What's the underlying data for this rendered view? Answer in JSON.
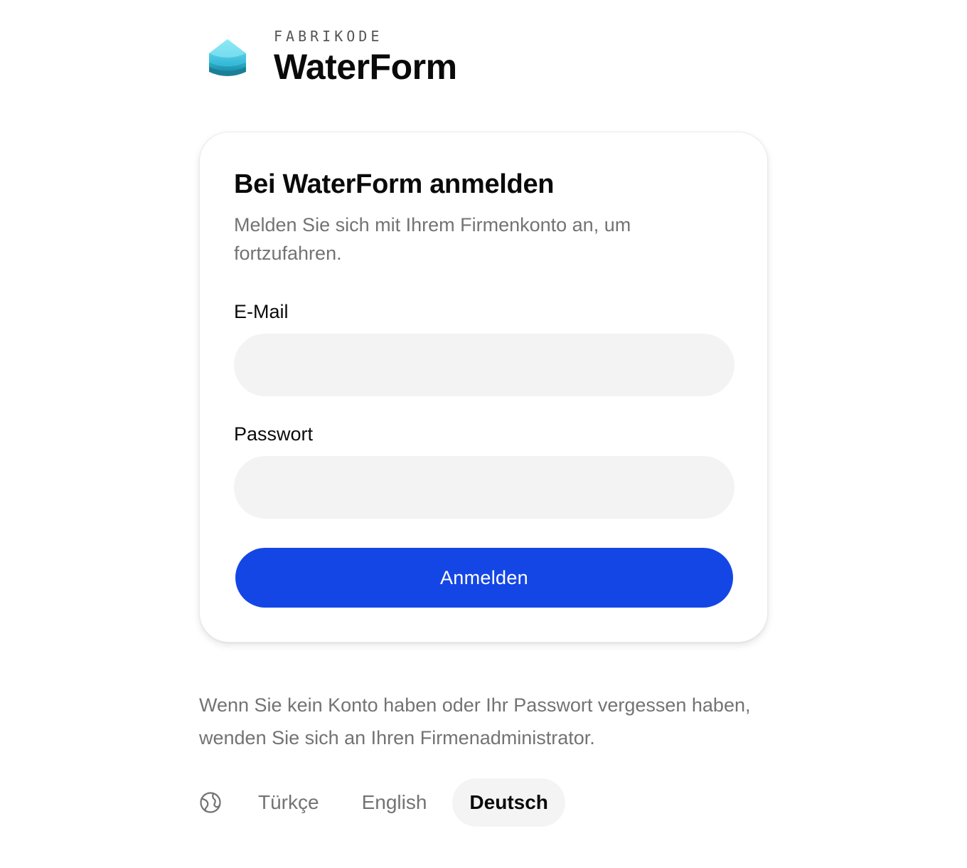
{
  "brand": {
    "company": "FABRIKODE",
    "product": "WaterForm",
    "logo_icon": "layered-water-drop-logo"
  },
  "login": {
    "title": "Bei WaterForm anmelden",
    "subtitle": "Melden Sie sich mit Ihrem Firmenkonto an, um fortzufahren.",
    "email_label": "E-Mail",
    "email_value": "",
    "email_placeholder": "",
    "password_label": "Passwort",
    "password_value": "",
    "password_placeholder": "",
    "submit_label": "Anmelden"
  },
  "help": {
    "text": "Wenn Sie kein Konto haben oder Ihr Passwort vergessen haben, wenden Sie sich an Ihren Firmenadministrator."
  },
  "language": {
    "icon": "globe-icon",
    "options": [
      {
        "label": "Türkçe",
        "active": false
      },
      {
        "label": "English",
        "active": false
      },
      {
        "label": "Deutsch",
        "active": true
      }
    ]
  },
  "colors": {
    "primary": "#1446e6",
    "input_bg": "#f3f3f3",
    "muted_text": "#737373",
    "logo_top": "#5fd6ec",
    "logo_bottom": "#1b8ea6"
  }
}
